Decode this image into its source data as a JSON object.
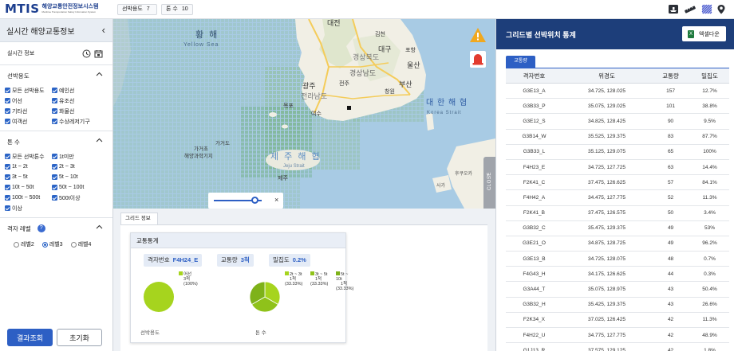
{
  "header": {
    "logo_text": "MTIS",
    "logo_korean": "해양교통안전정보시스템",
    "logo_english": "Maritime Transportation Safety Information System",
    "chips": [
      {
        "label": "선박용도",
        "value": "7"
      },
      {
        "label": "톤 수",
        "value": "10"
      }
    ],
    "icons": [
      "vessel-icon",
      "ruler-icon",
      "grid-pattern-icon",
      "location-pin-icon"
    ]
  },
  "sidebar": {
    "title": "실시간 해양교통정보",
    "realtime_label": "실시간 정보",
    "vessel_use": {
      "title": "선박용도",
      "options": [
        "모든 선박용도",
        "예인선",
        "어선",
        "유조선",
        "기타선",
        "화물선",
        "여객선",
        "수상레저기구"
      ]
    },
    "tonnage": {
      "title": "톤 수",
      "options": [
        "모든 선박톤수",
        "1t미만",
        "1t ~ 2t",
        "2t ~ 3t",
        "3t ~ 5t",
        "5t ~ 10t",
        "10t ~ 50t",
        "50t ~ 100t",
        "100t ~ 500t",
        "500t이상",
        "이상"
      ]
    },
    "grid_level": {
      "title": "격자 레벨",
      "help": "?",
      "options": [
        "레벨2",
        "레벨3",
        "레벨4"
      ],
      "selected": "레벨3"
    },
    "search_button": "결과조회",
    "reset_button": "초기화"
  },
  "map": {
    "labels": {
      "yellow_sea_ko": "황 해",
      "yellow_sea_en": "Yellow Sea",
      "korea_strait_ko": "대 한 해 협",
      "korea_strait_en": "Korea Strait",
      "jeju_ko": "제 주 해 협",
      "jeju_en": "Jeju Strait",
      "sea_area_1": "가거초",
      "sea_area_2": "해양과학기지",
      "sea_area_3": "가거도",
      "daejeon": "대전",
      "daegu": "대구",
      "ulsan": "울산",
      "busan": "부산",
      "gwangju": "광주",
      "jeonju": "전주",
      "mokpo": "목포",
      "gyeongsangnam": "경상남도",
      "gyeongbuk": "경상북도",
      "jeonnam": "전라남도",
      "jeju": "제주",
      "goto": "후쿠오카",
      "saga": "사가",
      "changwon": "창원",
      "gimcheon": "김천",
      "pohang": "포항",
      "yeosu": "여수"
    },
    "slider_value": 0.85,
    "close_label": "CLOSE",
    "close_x": "×",
    "collapse_arrow": "›"
  },
  "grid_info": {
    "tab_label": "그리드 정보",
    "card_title": "교통통계",
    "grid_id_label": "격자번호",
    "grid_id_value": "F4H24_E",
    "traffic_label": "교통량",
    "traffic_value": "3척",
    "density_label": "밀집도",
    "density_value": "0.2%",
    "pie1": {
      "caption": "선박용도",
      "legend": [
        {
          "name": "어선",
          "count": "3척",
          "pct": "(100%)",
          "color": "#a6d41e"
        }
      ],
      "values": [
        1
      ]
    },
    "pie2": {
      "caption": "톤 수",
      "legend": [
        {
          "name": "2t ~ 3t",
          "count": "1척",
          "pct": "(33.33%)",
          "color": "#a6d41e"
        },
        {
          "name": "3t ~ 5t",
          "count": "1척",
          "pct": "(33.33%)",
          "color": "#8fc21a"
        },
        {
          "name": "5t ~ 10t",
          "count": "1척",
          "pct": "(33.33%)",
          "color": "#7eb219"
        }
      ],
      "values": [
        1,
        1,
        1
      ]
    }
  },
  "stats_panel": {
    "title": "그리드별 선박위치 통계",
    "excel_button": "엑셀다운",
    "tab": "교통량",
    "columns": [
      "격자번호",
      "위경도",
      "교통량",
      "밀집도"
    ],
    "rows": [
      [
        "G3E13_A",
        "34.725, 128.025",
        "157",
        "12.7%"
      ],
      [
        "G3B33_P",
        "35.075, 129.025",
        "101",
        "38.8%"
      ],
      [
        "G3E12_S",
        "34.825, 128.425",
        "90",
        "9.5%"
      ],
      [
        "G3B14_W",
        "35.525, 129.375",
        "83",
        "87.7%"
      ],
      [
        "G3B33_L",
        "35.125, 129.075",
        "65",
        "100%"
      ],
      [
        "F4H23_E",
        "34.725, 127.725",
        "63",
        "14.4%"
      ],
      [
        "F2K41_C",
        "37.475, 126.625",
        "57",
        "84.1%"
      ],
      [
        "F4H42_A",
        "34.475, 127.775",
        "52",
        "11.3%"
      ],
      [
        "F2K41_B",
        "37.475, 126.575",
        "50",
        "3.4%"
      ],
      [
        "G3B32_C",
        "35.475, 129.375",
        "49",
        "53%"
      ],
      [
        "G3E21_O",
        "34.875, 128.725",
        "49",
        "96.2%"
      ],
      [
        "G3E13_B",
        "34.725, 128.075",
        "48",
        "0.7%"
      ],
      [
        "F4G43_H",
        "34.175, 126.625",
        "44",
        "0.3%"
      ],
      [
        "G3A44_T",
        "35.075, 128.975",
        "43",
        "50.4%"
      ],
      [
        "G3B32_H",
        "35.425, 129.375",
        "43",
        "26.6%"
      ],
      [
        "F2K34_X",
        "37.025, 126.425",
        "42",
        "11.3%"
      ],
      [
        "F4H22_U",
        "34.775, 127.775",
        "42",
        "48.9%"
      ],
      [
        "G1J13_R",
        "37.575, 129.125",
        "42",
        "1.8%"
      ]
    ]
  }
}
